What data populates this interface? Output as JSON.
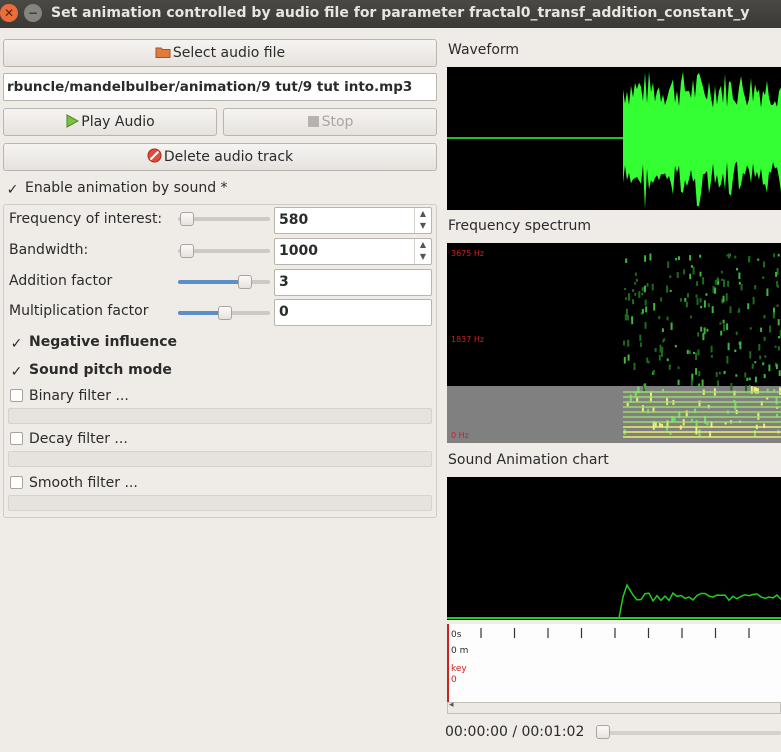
{
  "window": {
    "title": "Set animation controlled by audio file for parameter fractal0_transf_addition_constant_y"
  },
  "buttons": {
    "select_audio": "Select audio file",
    "play_audio": "Play Audio",
    "stop": "Stop",
    "delete_track": "Delete audio track"
  },
  "file_path": "rbuncle/mandelbulber/animation/9 tut/9 tut into.mp3",
  "enable_animation": {
    "label": "Enable animation by sound *",
    "checked": true
  },
  "params": {
    "frequency": {
      "label": "Frequency of interest:",
      "value": "580"
    },
    "bandwidth": {
      "label": "Bandwidth:",
      "value": "1000"
    },
    "addition": {
      "label": "Addition factor",
      "value": "3"
    },
    "multiplication": {
      "label": "Multiplication factor",
      "value": "0"
    }
  },
  "options": {
    "negative_influence": {
      "label": "Negative influence",
      "checked": true
    },
    "sound_pitch": {
      "label": "Sound pitch mode",
      "checked": true
    },
    "binary_filter": {
      "label": "Binary filter ...",
      "checked": false
    },
    "decay_filter": {
      "label": "Decay filter ...",
      "checked": false
    },
    "smooth_filter": {
      "label": "Smooth filter ...",
      "checked": false
    }
  },
  "panels": {
    "waveform_title": "Waveform",
    "spectrum_title": "Frequency spectrum",
    "spectrum_labels": {
      "high": "3675 Hz",
      "mid": "1837 Hz",
      "low": "0 Hz"
    },
    "chart_title": "Sound Animation chart"
  },
  "timeline": {
    "time_marker": "0s",
    "minute_marker": "0 m",
    "key_label": "key",
    "key_value": "0"
  },
  "playback": {
    "current_time": "00:00:00 / 00:01:02"
  },
  "colors": {
    "waveform": "#33ff33",
    "chart_line": "#22cc22",
    "spectrum_marker": "#cc2222"
  }
}
